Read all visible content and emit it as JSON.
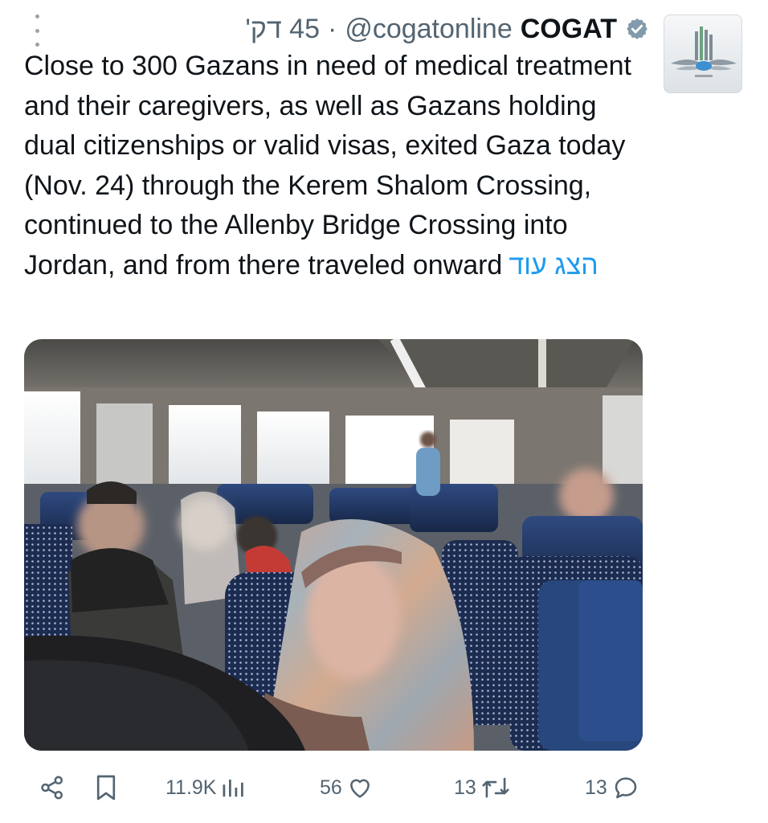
{
  "tweet": {
    "author_name": "COGAT",
    "author_handle": "@cogatonline",
    "separator": "·",
    "timestamp": "45 דק'",
    "text": "Close to 300 Gazans in need of medical treatment and their caregivers, as well as Gazans holding dual citizenships or valid visas, exited Gaza today (Nov. 24) through the Kerem Shalom Crossing, continued to the Allenby Bridge Crossing into Jordan, and from there traveled onward",
    "show_more": "הצג עוד"
  },
  "stats": {
    "views": "11.9K",
    "likes": "56",
    "retweets": "13",
    "replies": "13"
  },
  "colors": {
    "link": "#1d9bf0",
    "muted": "#536471",
    "text": "#0f1419"
  },
  "icons": [
    "more-vertical-icon",
    "verified-badge-icon",
    "share-icon",
    "bookmark-icon",
    "views-icon",
    "like-icon",
    "retweet-icon",
    "reply-icon"
  ]
}
